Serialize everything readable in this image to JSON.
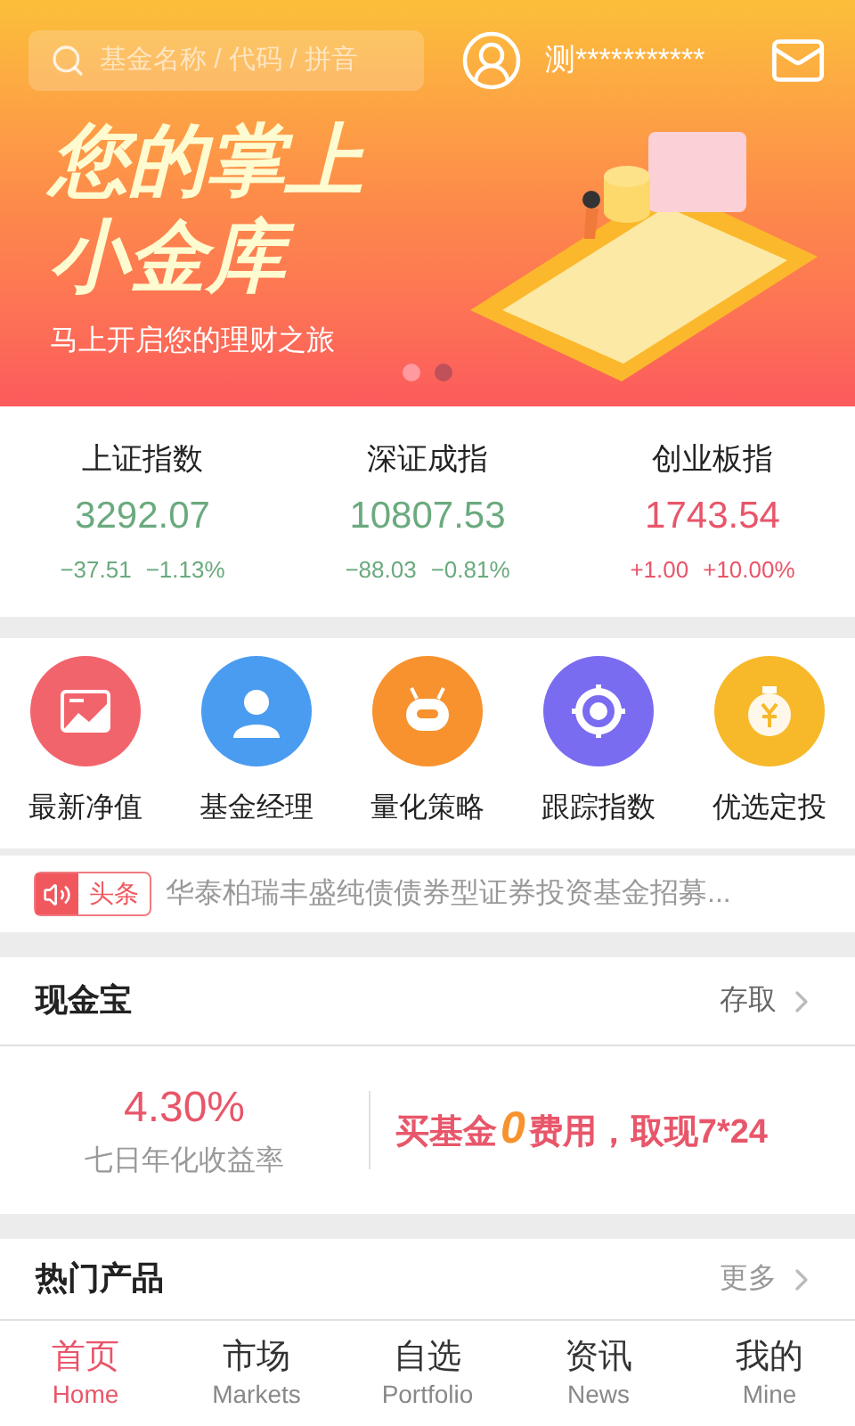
{
  "header": {
    "search": {
      "placeholder": "基金名称 / 代码 / 拼音"
    },
    "username": "测***********"
  },
  "banner": {
    "title_lines": [
      "您的掌上",
      "小金库"
    ],
    "subtitle": "马上开启您的理财之旅",
    "dots": [
      {
        "selected": false
      },
      {
        "selected": true
      }
    ]
  },
  "indices": [
    {
      "name": "上证指数",
      "value": "3292.07",
      "change": "−37.51",
      "percent": "−1.13%",
      "kind": "down"
    },
    {
      "name": "深证成指",
      "value": "10807.53",
      "change": "−88.03",
      "percent": "−0.81%",
      "kind": "down"
    },
    {
      "name": "创业板指",
      "value": "1743.54",
      "change": "+1.00",
      "percent": "+10.00%",
      "kind": "up"
    }
  ],
  "shortcuts": [
    {
      "label": "最新净值",
      "color": "#f2646c"
    },
    {
      "label": "基金经理",
      "color": "#4a9cf0"
    },
    {
      "label": "量化策略",
      "color": "#f7922e"
    },
    {
      "label": "跟踪指数",
      "color": "#7a6cf0"
    },
    {
      "label": "优选定投",
      "color": "#f7b92a"
    }
  ],
  "news": {
    "tag": "头条",
    "text": "华泰柏瑞丰盛纯债债券型证券投资基金招募..."
  },
  "cash": {
    "title": "现金宝",
    "action": "存取",
    "rate": "4.30%",
    "rate_label": "七日年化收益率",
    "promo": {
      "before": "买基金",
      "highlight": "0",
      "after": "费用，取现7*24"
    }
  },
  "hot": {
    "title": "热门产品",
    "action": "更多"
  },
  "tabs": [
    {
      "label": "首页",
      "sublabel": "Home",
      "selected": true
    },
    {
      "label": "市场",
      "sublabel": "Markets",
      "selected": false
    },
    {
      "label": "自选",
      "sublabel": "Portfolio",
      "selected": false
    },
    {
      "label": "资讯",
      "sublabel": "News",
      "selected": false
    },
    {
      "label": "我的",
      "sublabel": "Mine",
      "selected": false
    }
  ]
}
